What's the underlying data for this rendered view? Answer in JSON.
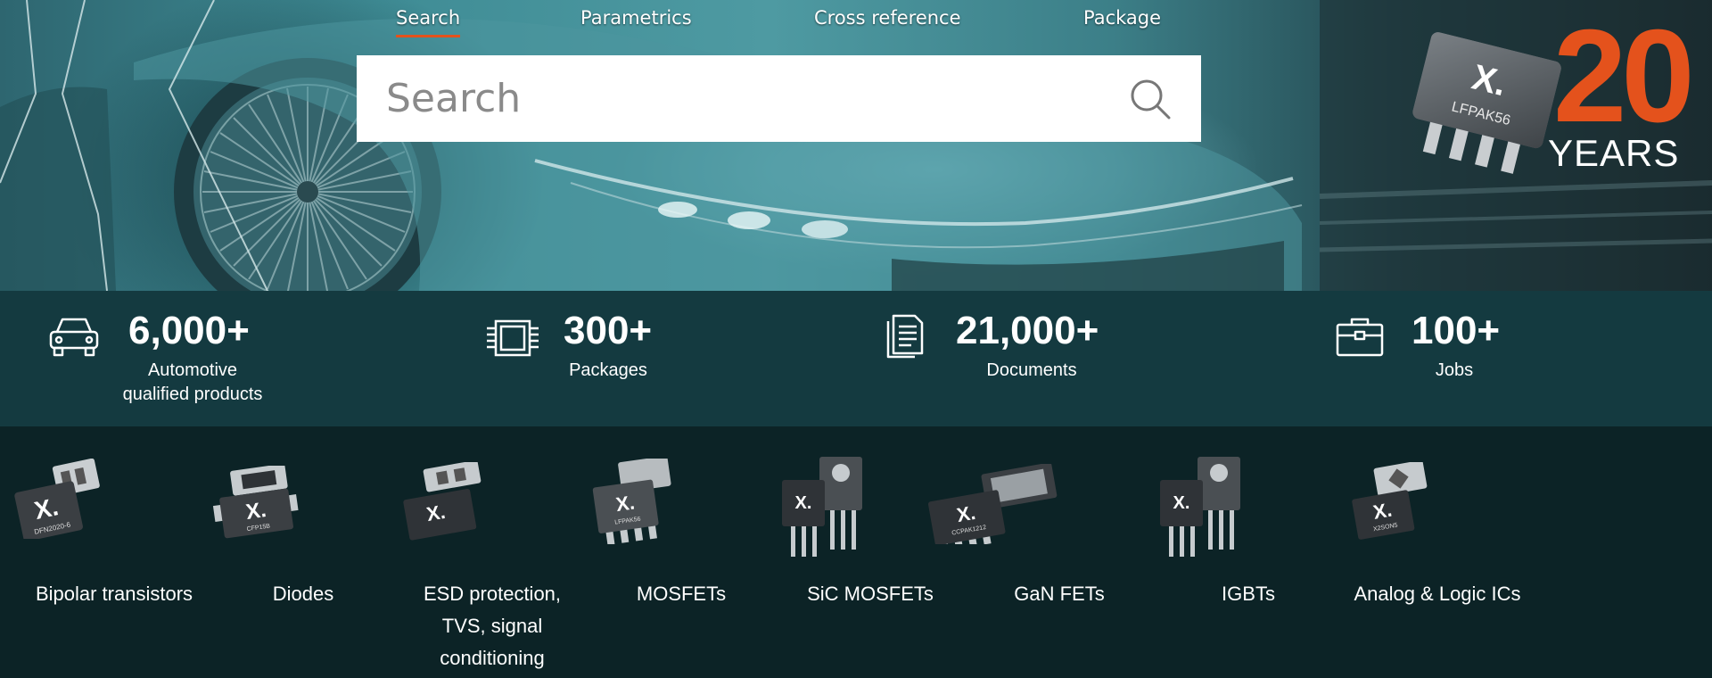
{
  "nav": {
    "tabs": [
      {
        "label": "Search",
        "active": true
      },
      {
        "label": "Parametrics",
        "active": false
      },
      {
        "label": "Cross reference",
        "active": false
      },
      {
        "label": "Package",
        "active": false
      }
    ]
  },
  "search": {
    "placeholder": "Search",
    "icon": "search-icon"
  },
  "badge": {
    "chip_label": "LFPAK56",
    "number": "20",
    "years": "YEARS",
    "accent": "#e4521c"
  },
  "stats": [
    {
      "icon": "car-icon",
      "value": "6,000+",
      "label_line1": "Automotive",
      "label_line2": "qualified products"
    },
    {
      "icon": "chip-package-icon",
      "value": "300+",
      "label_line1": "Packages",
      "label_line2": ""
    },
    {
      "icon": "documents-icon",
      "value": "21,000+",
      "label_line1": "Documents",
      "label_line2": ""
    },
    {
      "icon": "briefcase-icon",
      "value": "100+",
      "label_line1": "Jobs",
      "label_line2": ""
    }
  ],
  "categories": [
    {
      "label": "Bipolar transistors",
      "lines": [
        "Bipolar transistors"
      ],
      "chip_label": "DFN2020-6"
    },
    {
      "label": "Diodes",
      "lines": [
        "Diodes"
      ],
      "chip_label": "CFP15B"
    },
    {
      "label": "ESD protection, TVS, signal conditioning",
      "lines": [
        "ESD protection,",
        "TVS, signal",
        "conditioning"
      ],
      "chip_label": ""
    },
    {
      "label": "MOSFETs",
      "lines": [
        "MOSFETs"
      ],
      "chip_label": "LFPAK56"
    },
    {
      "label": "SiC MOSFETs",
      "lines": [
        "SiC MOSFETs"
      ],
      "chip_label": ""
    },
    {
      "label": "GaN FETs",
      "lines": [
        "GaN FETs"
      ],
      "chip_label": "CCPAK1212"
    },
    {
      "label": "IGBTs",
      "lines": [
        "IGBTs"
      ],
      "chip_label": ""
    },
    {
      "label": "Analog & Logic ICs",
      "lines": [
        "Analog & Logic ICs"
      ],
      "chip_label": "X2SON5"
    }
  ],
  "colors": {
    "accent": "#e4521c",
    "stats_bg": "#143a40",
    "categories_bg": "#0c2326"
  }
}
